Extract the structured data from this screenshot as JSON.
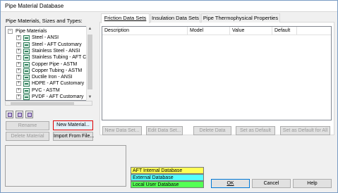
{
  "window": {
    "title": "Pipe Material Database"
  },
  "left": {
    "tree_label": "Pipe Materials, Sizes and Types:",
    "tree": [
      {
        "label": "Pipe Materials",
        "level": 0,
        "expander": "−"
      },
      {
        "label": "Steel - ANSI",
        "level": 1,
        "expander": "+"
      },
      {
        "label": "Steel - AFT Customary",
        "level": 1,
        "expander": "+"
      },
      {
        "label": "Stainless Steel - ANSI",
        "level": 1,
        "expander": "+"
      },
      {
        "label": "Stainless Tubing - AFT Cus",
        "level": 1,
        "expander": "+"
      },
      {
        "label": "Copper Pipe - ASTM",
        "level": 1,
        "expander": "+"
      },
      {
        "label": "Copper Tubing - ASTM",
        "level": 1,
        "expander": "+"
      },
      {
        "label": "Ductile Iron - ANSI",
        "level": 1,
        "expander": "+"
      },
      {
        "label": "HDPE - AFT Customary",
        "level": 1,
        "expander": "+"
      },
      {
        "label": "PVC - ASTM",
        "level": 1,
        "expander": "+"
      },
      {
        "label": "PVDF - AFT Customary",
        "level": 1,
        "expander": "+"
      }
    ],
    "buttons": {
      "rename": "Rename",
      "new_material": "New Material...",
      "delete_material": "Delete Material",
      "import_from_file": "Import From File..."
    }
  },
  "tabs": [
    {
      "label": "Friction Data Sets",
      "active": true
    },
    {
      "label": "Insulation Data Sets",
      "active": false
    },
    {
      "label": "Pipe Thermophysical Properties",
      "active": false
    }
  ],
  "grid": {
    "columns": [
      "Description",
      "Model",
      "Value",
      "Default"
    ]
  },
  "actions": {
    "new_data_set": "New Data Set...",
    "edit_data_set": "Edit Data Set...",
    "delete_data": "Delete Data",
    "set_as_default": "Set as Default",
    "set_as_default_for_all": "Set as Default for All"
  },
  "legend": [
    {
      "label": "AFT Internal Database",
      "color": "#ffff55"
    },
    {
      "label": "External Database",
      "color": "#55ffff"
    },
    {
      "label": "Local User Database",
      "color": "#55ff55"
    }
  ],
  "footer": {
    "ok": "OK",
    "cancel": "Cancel",
    "help": "Help"
  }
}
